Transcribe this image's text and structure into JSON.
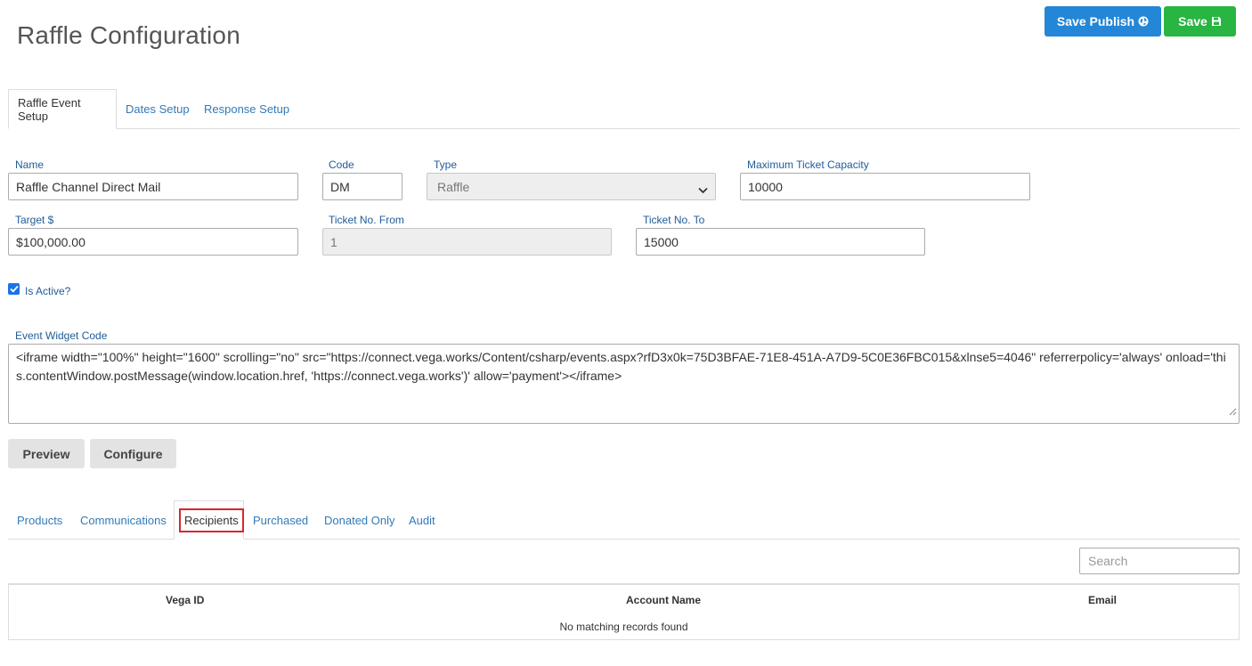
{
  "page": {
    "title": "Raffle Configuration"
  },
  "header_buttons": {
    "save_publish": "Save Publish",
    "save": "Save"
  },
  "top_tabs": [
    {
      "label": "Raffle Event Setup",
      "active": true
    },
    {
      "label": "Dates Setup",
      "active": false
    },
    {
      "label": "Response Setup",
      "active": false
    }
  ],
  "form": {
    "name": {
      "label": "Name",
      "value": "Raffle Channel Direct Mail"
    },
    "code": {
      "label": "Code",
      "value": "DM"
    },
    "type": {
      "label": "Type",
      "value": "Raffle"
    },
    "max_capacity": {
      "label": "Maximum Ticket Capacity",
      "value": "10000"
    },
    "target": {
      "label": "Target $",
      "value": "$100,000.00"
    },
    "ticket_from": {
      "label": "Ticket No. From",
      "value": "1"
    },
    "ticket_to": {
      "label": "Ticket No. To",
      "value": "15000"
    },
    "is_active": {
      "label": "Is Active?",
      "checked": true
    },
    "widget_code": {
      "label": "Event Widget Code",
      "value": "<iframe width=\"100%\" height=\"1600\" scrolling=\"no\" src=\"https://connect.vega.works/Content/csharp/events.aspx?rfD3x0k=75D3BFAE-71E8-451A-A7D9-5C0E36FBC015&xlnse5=4046\" referrerpolicy='always' onload='this.contentWindow.postMessage(window.location.href, 'https://connect.vega.works')' allow='payment'></iframe>"
    }
  },
  "action_buttons": {
    "preview": "Preview",
    "configure": "Configure"
  },
  "bottom_tabs": [
    {
      "label": "Products",
      "active": false
    },
    {
      "label": "Communications",
      "active": false
    },
    {
      "label": "Recipients",
      "active": true
    },
    {
      "label": "Purchased",
      "active": false
    },
    {
      "label": "Donated Only",
      "active": false
    },
    {
      "label": "Audit",
      "active": false
    }
  ],
  "search": {
    "placeholder": "Search"
  },
  "table": {
    "columns": [
      "Vega ID",
      "Account Name",
      "Email"
    ],
    "empty_message": "No matching records found"
  },
  "colors": {
    "primary": "#2486d6",
    "success": "#28b542",
    "link": "#337ab7",
    "highlight": "#d9262c"
  },
  "icons": {
    "save_publish": "globe-icon",
    "save": "floppy-disk-icon",
    "type_select": "chevron-down-icon",
    "checkbox": "checkmark-icon"
  }
}
